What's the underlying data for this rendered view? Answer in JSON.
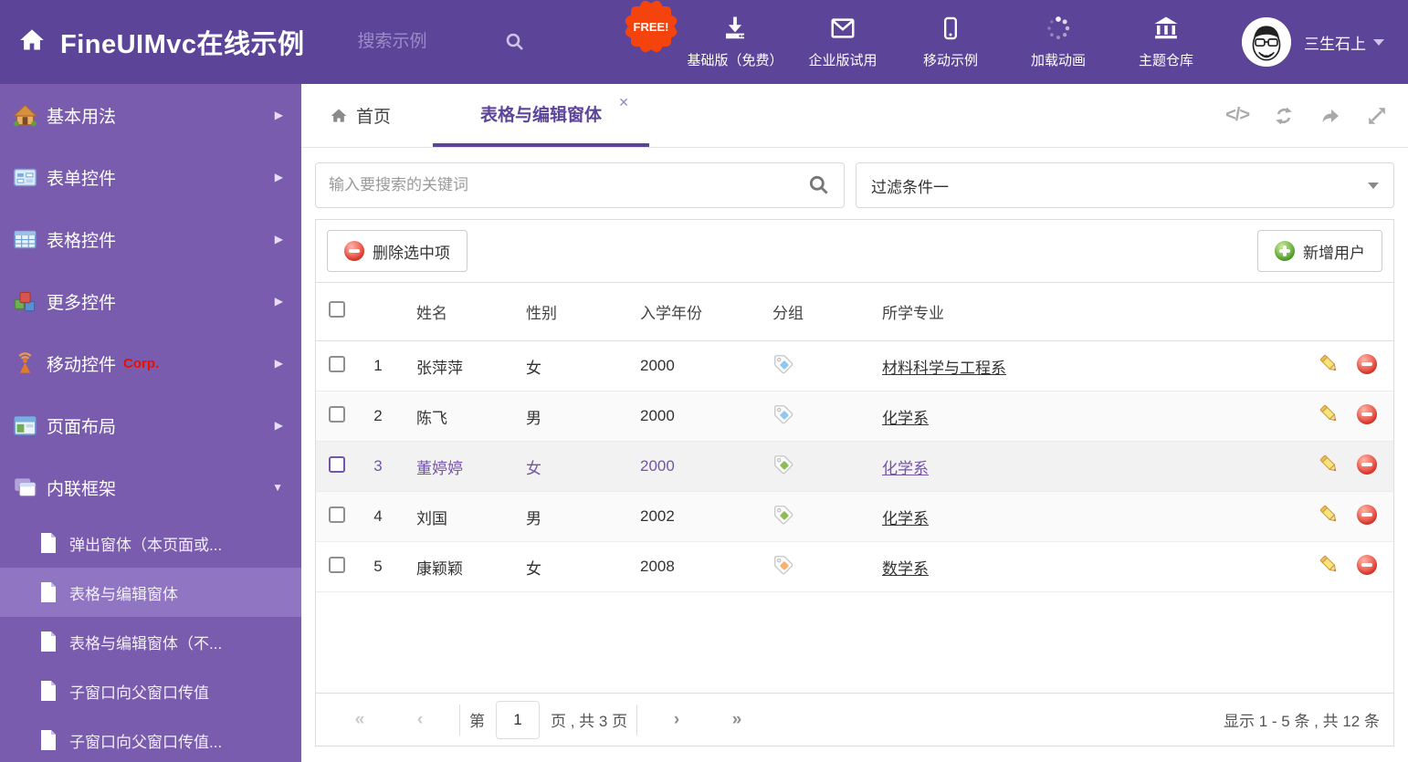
{
  "header": {
    "title": "FineUIMvc在线示例",
    "search_placeholder": "搜索示例",
    "free_badge": "FREE!",
    "nav_items": [
      {
        "label": "基础版（免费）",
        "icon": "download-icon"
      },
      {
        "label": "企业版试用",
        "icon": "envelope-icon"
      },
      {
        "label": "移动示例",
        "icon": "mobile-icon"
      },
      {
        "label": "加载动画",
        "icon": "spinner-icon"
      },
      {
        "label": "主题仓库",
        "icon": "bank-icon"
      }
    ],
    "username": "三生石上"
  },
  "sidebar": {
    "items": [
      {
        "label": "基本用法",
        "icon": "house-icon"
      },
      {
        "label": "表单控件",
        "icon": "form-icon"
      },
      {
        "label": "表格控件",
        "icon": "table-icon"
      },
      {
        "label": "更多控件",
        "icon": "cubes-icon"
      },
      {
        "label": "移动控件",
        "icon": "antenna-icon",
        "badge": "Corp."
      },
      {
        "label": "页面布局",
        "icon": "layout-icon"
      },
      {
        "label": "内联框架",
        "icon": "windows-icon",
        "expanded": true
      }
    ],
    "subitems": [
      {
        "label": "弹出窗体（本页面或..."
      },
      {
        "label": "表格与编辑窗体",
        "selected": true
      },
      {
        "label": "表格与编辑窗体（不..."
      },
      {
        "label": "子窗口向父窗口传值"
      },
      {
        "label": "子窗口向父窗口传值..."
      }
    ]
  },
  "tabs": [
    {
      "label": "首页"
    },
    {
      "label": "表格与编辑窗体",
      "active": true
    }
  ],
  "filters": {
    "search_placeholder": "输入要搜索的关键词",
    "filter_value": "过滤条件一"
  },
  "toolbar": {
    "delete_selected": "删除选中项",
    "add_user": "新增用户"
  },
  "table": {
    "columns": [
      "姓名",
      "性别",
      "入学年份",
      "分组",
      "所学专业"
    ],
    "rows": [
      {
        "num": "1",
        "name": "张萍萍",
        "gender": "女",
        "year": "2000",
        "tag_color": "#8fc7f1",
        "major": "材料科学与工程系"
      },
      {
        "num": "2",
        "name": "陈飞",
        "gender": "男",
        "year": "2000",
        "tag_color": "#8fc7f1",
        "major": "化学系"
      },
      {
        "num": "3",
        "name": "董婷婷",
        "gender": "女",
        "year": "2000",
        "tag_color": "#8cbb58",
        "major": "化学系",
        "selected": true
      },
      {
        "num": "4",
        "name": "刘国",
        "gender": "男",
        "year": "2002",
        "tag_color": "#8cbb58",
        "major": "化学系"
      },
      {
        "num": "5",
        "name": "康颖颖",
        "gender": "女",
        "year": "2008",
        "tag_color": "#f9b26e",
        "major": "数学系"
      }
    ]
  },
  "pagination": {
    "page_prefix": "第",
    "current_page": "1",
    "page_suffix": "页 , 共 3 页",
    "summary": "显示 1 - 5 条 , 共 12 条"
  },
  "colors": {
    "header_bg": "#5c4498",
    "sidebar_bg": "#7a5cae",
    "sidebar_selected": "#8f75c2",
    "accent_purple": "#5c4498",
    "selected_row_text": "#7454a8",
    "free_badge": "#f5430e",
    "delete_red": "#e64034",
    "add_green": "#57a72c",
    "tag_blue": "#8fc7f1",
    "tag_green": "#8cbb58",
    "tag_orange": "#f9b26e"
  }
}
